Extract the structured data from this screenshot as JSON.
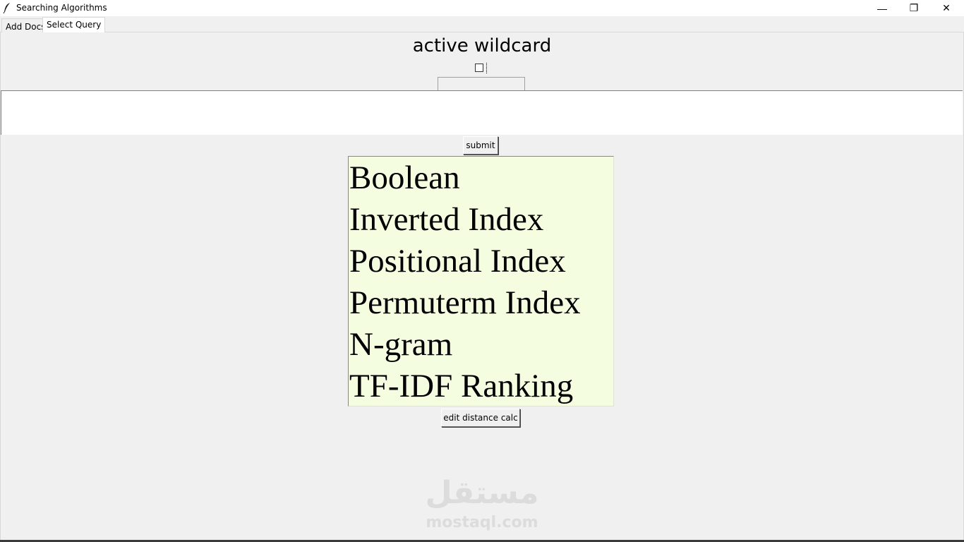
{
  "window": {
    "title": "Searching Algorithms",
    "controls": {
      "minimize": "—",
      "maximize": "❐",
      "close": "✕"
    }
  },
  "tabs": [
    {
      "label": "Add Docs",
      "active": false
    },
    {
      "label": "Select Query",
      "active": true
    }
  ],
  "main": {
    "heading": "active wildcard",
    "wildcard_checked": false,
    "query_text": "",
    "submit_label": "submit",
    "algorithms": [
      "Boolean",
      "Inverted Index",
      "Positional Index",
      "Permuterm Index",
      "N-gram",
      "TF-IDF Ranking"
    ],
    "edit_distance_label": "edit distance calc"
  },
  "watermark": {
    "arabic": "مستقل",
    "latin": "mostaql.com"
  },
  "colors": {
    "background": "#f0f0f0",
    "listbox_background": "#f5fde0",
    "text": "#000000"
  }
}
